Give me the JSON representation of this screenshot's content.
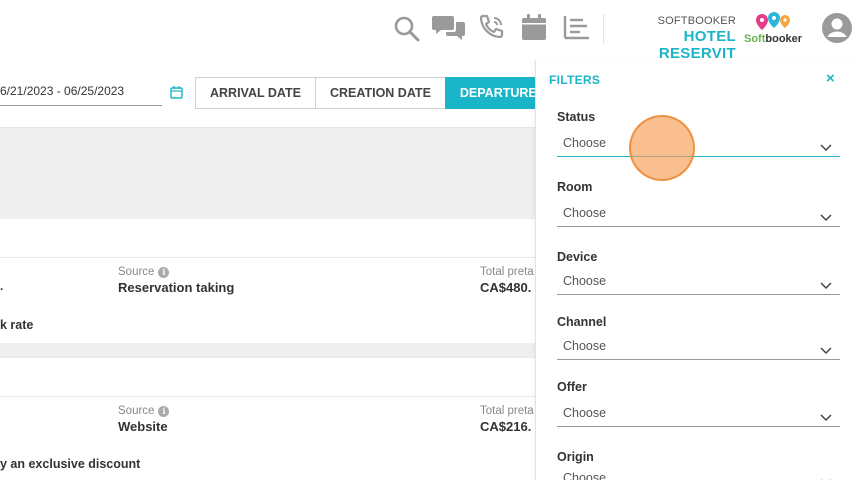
{
  "header": {
    "icons": [
      "search-icon",
      "chat-icon",
      "phone-icon",
      "calendar-icon",
      "list-icon",
      "user-icon"
    ],
    "brand_top": "SOFTBOOKER",
    "brand_name": "HOTEL RESERVIT",
    "logo_text_1": "Soft",
    "logo_text_2": "booker",
    "accent_color": "#1ab5c8"
  },
  "toolbar": {
    "date_range": "6/21/2023 - 06/25/2023",
    "date_buttons": [
      "ARRIVAL DATE",
      "CREATION DATE",
      "DEPARTURE D"
    ],
    "active_button": "DEPARTURE D"
  },
  "reservations": [
    {
      "source_label": "Source",
      "source_value": "Reservation taking",
      "total_label": "Total preta",
      "total_value": "CA$480.",
      "note": "k rate"
    },
    {
      "source_label": "Source",
      "source_value": "Website",
      "total_label": "Total preta",
      "total_value": "CA$216.",
      "note": "y an exclusive discount"
    }
  ],
  "filters": {
    "title": "FILTERS",
    "close": "×",
    "fields": [
      {
        "label": "Status",
        "value": "Choose"
      },
      {
        "label": "Room",
        "value": "Choose"
      },
      {
        "label": "Device",
        "value": "Choose"
      },
      {
        "label": "Channel",
        "value": "Choose"
      },
      {
        "label": "Offer",
        "value": "Choose"
      },
      {
        "label": "Origin",
        "value": "Choose"
      }
    ]
  }
}
